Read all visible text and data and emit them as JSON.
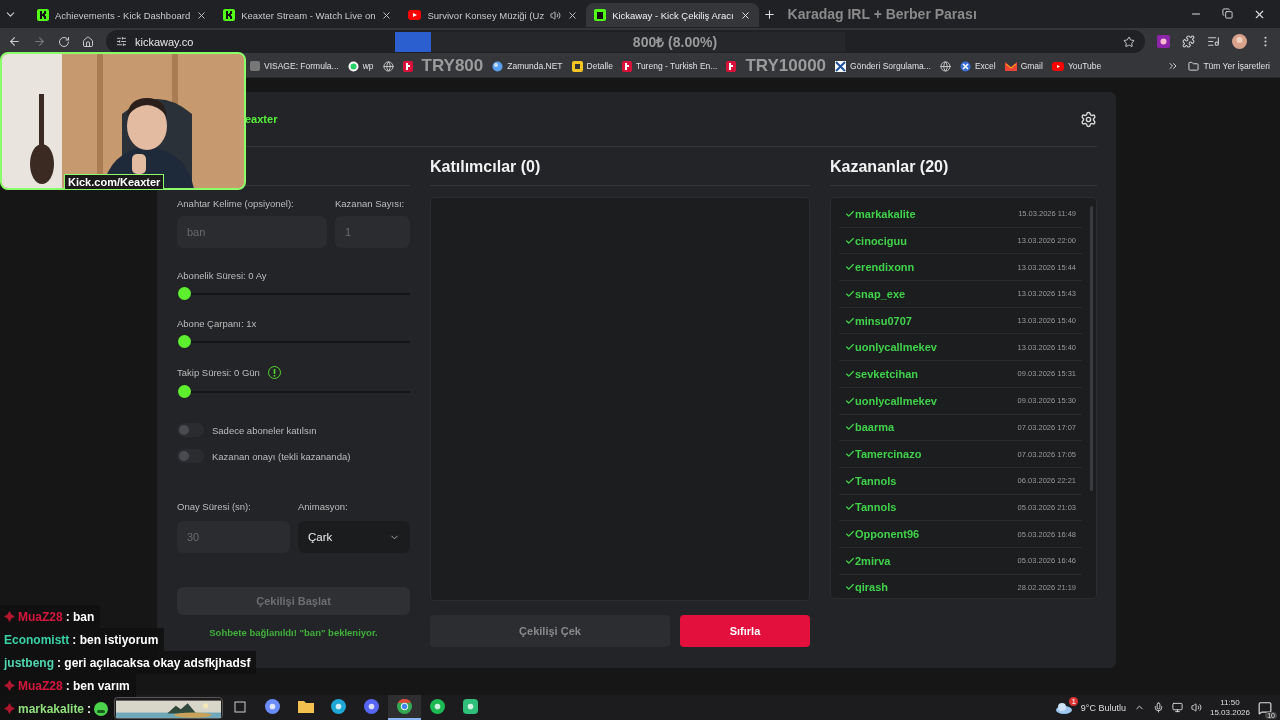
{
  "browser": {
    "tabs": [
      {
        "title": "Achievements - Kick Dashboard",
        "kind": "kick",
        "selected": false
      },
      {
        "title": "Keaxter Stream - Watch Live on",
        "kind": "kick",
        "selected": false
      },
      {
        "title": "Survivor Konsey Müziği (Uz",
        "kind": "youtube",
        "selected": false,
        "audio": true
      },
      {
        "title": "Kickaway - Kick Çekiliş Aracı",
        "kind": "kickaway",
        "selected": true
      }
    ],
    "stream_title": "Karadag IRL + Berber Parası",
    "address_bar": {
      "url": "kickaway.co",
      "goal": {
        "level": 0.08,
        "text": "800₺ (8.00%)"
      }
    },
    "bookmarks": [
      {
        "kind": "site",
        "label": "VISAGE: Formula..."
      },
      {
        "kind": "whatsapp",
        "label": "wp"
      },
      {
        "kind": "globe"
      },
      {
        "kind": "tureng"
      },
      {
        "kind": "overlay",
        "label": "TRY800"
      },
      {
        "kind": "zamunda",
        "label": "Zamunda.NET"
      },
      {
        "kind": "detalle",
        "label": "Detalle"
      },
      {
        "kind": "tureng",
        "label": "Tureng - Turkish En..."
      },
      {
        "kind": "tureng"
      },
      {
        "kind": "overlay",
        "label": "TRY10000"
      },
      {
        "kind": "gonderi",
        "label": "Gönderi Sorgulama..."
      },
      {
        "kind": "globe"
      },
      {
        "kind": "excel",
        "label": "Excel"
      },
      {
        "kind": "gmail",
        "label": "Gmail"
      },
      {
        "kind": "youtube",
        "label": "YouTube"
      }
    ],
    "all_bookmarks": "Tüm Yer İşaretleri"
  },
  "webcam": {
    "caption": "Kick.com/Keaxter"
  },
  "app": {
    "channel": "eaxter",
    "form": {
      "keyword": {
        "label": "Anahtar Kelime (opsiyonel):",
        "placeholder": "ban"
      },
      "winner_count": {
        "label": "Kazanan Sayısı:",
        "placeholder": "1"
      },
      "sliders": [
        {
          "label": "Abonelik Süresi: 0 Ay",
          "level": 0,
          "info": false
        },
        {
          "label": "Abone Çarpanı: 1x",
          "level": 0,
          "info": false
        },
        {
          "label": "Takip Süresi:  0  Gün",
          "level": 0,
          "info": true
        }
      ],
      "toggles": [
        {
          "label": "Sadece aboneler katılsın",
          "on": false
        },
        {
          "label": "Kazanan onayı (tekli kazananda)",
          "on": false
        }
      ],
      "confirm_time": {
        "label": "Onay Süresi (sn):",
        "placeholder": "30"
      },
      "animation": {
        "label": "Animasyon:",
        "value": "Çark"
      },
      "start_button": {
        "label": "Çekilişi Başlat",
        "disabled": true
      },
      "status": "Sohbete bağlanıldı! \"ban\" bekleniyor."
    },
    "participants": {
      "title": "Katılımcılar (0)"
    },
    "draw_button": {
      "label": "Çekilişi Çek",
      "disabled": true
    },
    "reset_button": {
      "label": "Sıfırla"
    },
    "winners": {
      "title": "Kazananlar (20)",
      "items": [
        {
          "name": "markakalite",
          "date": "15.03.2026 11:49"
        },
        {
          "name": "cinociguu",
          "date": "13.03.2026 22:00"
        },
        {
          "name": "erendixonn",
          "date": "13.03.2026 15:44"
        },
        {
          "name": "snap_exe",
          "date": "13.03.2026 15:43"
        },
        {
          "name": "minsu0707",
          "date": "13.03.2026 15:40"
        },
        {
          "name": "uonlycallmekev",
          "date": "13.03.2026 15:40"
        },
        {
          "name": "sevketcihan",
          "date": "09.03.2026 15:31"
        },
        {
          "name": "uonlycallmekev",
          "date": "09.03.2026 15:30"
        },
        {
          "name": "baarma",
          "date": "07.03.2026 17:07"
        },
        {
          "name": "Tamercinazo",
          "date": "07.03.2026 17:05"
        },
        {
          "name": "Tannols",
          "date": "06.03.2026 22:21"
        },
        {
          "name": "Tannols",
          "date": "05.03.2026 21:03"
        },
        {
          "name": "Opponent96",
          "date": "05.03.2026 16:48"
        },
        {
          "name": "2mirva",
          "date": "05.03.2026 16:46"
        },
        {
          "name": "qirash",
          "date": "28.02.2026 21:19"
        }
      ]
    }
  },
  "chat": [
    {
      "name": "MuaZ28",
      "color": "#d4173c",
      "badge": true,
      "text": ": ban",
      "emote": false
    },
    {
      "name": "Economistt",
      "color": "#3ad1a4",
      "badge": false,
      "text": ": ben istiyorum",
      "emote": false
    },
    {
      "name": "justbeng",
      "color": "#4fd6b0",
      "badge": false,
      "text": ": geri açılacaksa okay adsfkjhadsf",
      "emote": false
    },
    {
      "name": "MuaZ28",
      "color": "#d4173c",
      "badge": true,
      "text": ": ben varım",
      "emote": false
    },
    {
      "name": "markakalite",
      "color": "#8fe07a",
      "badge": true,
      "text": ":",
      "emote": true
    }
  ],
  "taskbar": {
    "apps": [
      {
        "kind": "taskview",
        "selected": false
      },
      {
        "kind": "copilot",
        "selected": false
      },
      {
        "kind": "files",
        "selected": false
      },
      {
        "kind": "edge",
        "selected": false
      },
      {
        "kind": "discord",
        "selected": false
      },
      {
        "kind": "chrome",
        "selected": true
      },
      {
        "kind": "spotify",
        "selected": false
      },
      {
        "kind": "app",
        "selected": false
      }
    ],
    "weather_badge": "1",
    "weather": "9°C Bulutlu",
    "time": "11:50",
    "date": "15.03.2026",
    "notifications": "10"
  }
}
